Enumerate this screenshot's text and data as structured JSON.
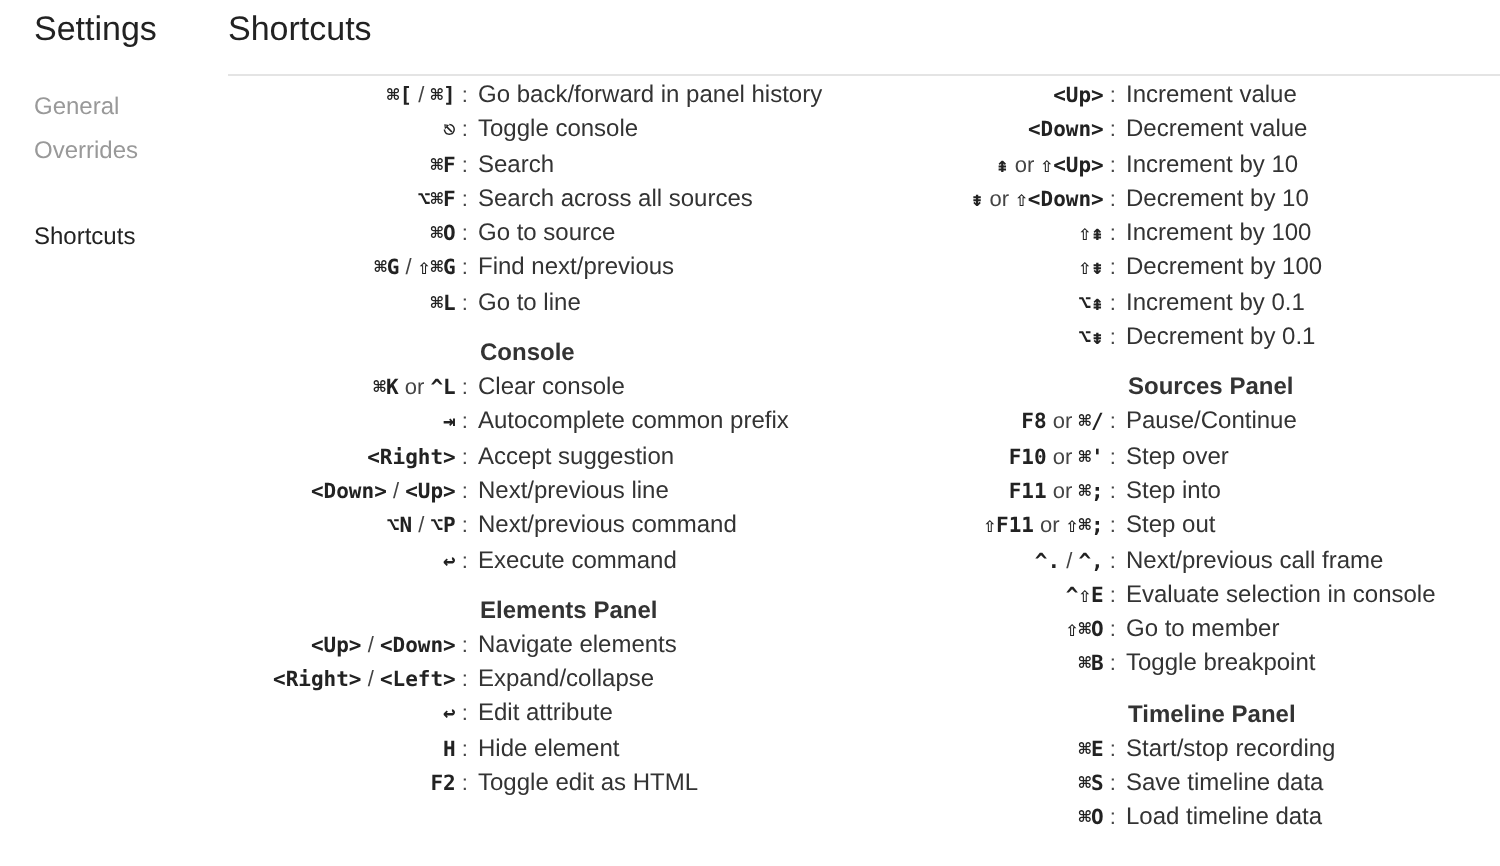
{
  "header": {
    "title": "Settings",
    "page_title": "Shortcuts"
  },
  "sidebar": {
    "items": [
      {
        "label": "General",
        "selected": false
      },
      {
        "label": "Overrides",
        "selected": false
      },
      {
        "label": "Shortcuts",
        "selected": true
      }
    ]
  },
  "columns": [
    {
      "sections": [
        {
          "rows": [
            {
              "keys": "**⌘[** / **⌘]** :",
              "action": "Go back/forward in panel history"
            },
            {
              "keys": "**⎋** :",
              "action": "Toggle console"
            },
            {
              "keys": "**⌘F** :",
              "action": "Search"
            },
            {
              "keys": "**⌥⌘F** :",
              "action": "Search across all sources"
            },
            {
              "keys": "**⌘O** :",
              "action": "Go to source"
            },
            {
              "keys": "**⌘G** / **⇧⌘G** :",
              "action": "Find next/previous"
            },
            {
              "keys": "**⌘L** :",
              "action": "Go to line"
            }
          ]
        },
        {
          "heading": "Console",
          "rows": [
            {
              "keys": "**⌘K** or **^L** :",
              "action": "Clear console"
            },
            {
              "keys": "**⇥** :",
              "action": "Autocomplete common prefix"
            },
            {
              "keys": "**<Right>** :",
              "action": "Accept suggestion"
            },
            {
              "keys": "**<Down>** / **<Up>** :",
              "action": "Next/previous line"
            },
            {
              "keys": "**⌥N** / **⌥P** :",
              "action": "Next/previous command"
            },
            {
              "keys": "**↩** :",
              "action": "Execute command"
            }
          ]
        },
        {
          "heading": "Elements Panel",
          "rows": [
            {
              "keys": "**<Up>** / **<Down>** :",
              "action": "Navigate elements"
            },
            {
              "keys": "**<Right>** / **<Left>** :",
              "action": "Expand/collapse"
            },
            {
              "keys": "**↩** :",
              "action": "Edit attribute"
            },
            {
              "keys": "**H** :",
              "action": "Hide element"
            },
            {
              "keys": "**F2** :",
              "action": "Toggle edit as HTML"
            }
          ]
        }
      ]
    },
    {
      "sections": [
        {
          "rows": [
            {
              "keys": "**<Up>** :",
              "action": "Increment value"
            },
            {
              "keys": "**<Down>** :",
              "action": "Decrement value"
            },
            {
              "keys": "**⇞** or **⇧<Up>** :",
              "action": "Increment by 10"
            },
            {
              "keys": "**⇟** or **⇧<Down>** :",
              "action": "Decrement by 10"
            },
            {
              "keys": "**⇧⇞** :",
              "action": "Increment by 100"
            },
            {
              "keys": "**⇧⇟** :",
              "action": "Decrement by 100"
            },
            {
              "keys": "**⌥⇞** :",
              "action": "Increment by 0.1"
            },
            {
              "keys": "**⌥⇟** :",
              "action": "Decrement by 0.1"
            }
          ]
        },
        {
          "heading": "Sources Panel",
          "rows": [
            {
              "keys": "**F8** or **⌘/** :",
              "action": "Pause/Continue"
            },
            {
              "keys": "**F10** or **⌘'** :",
              "action": "Step over"
            },
            {
              "keys": "**F11** or **⌘;** :",
              "action": "Step into"
            },
            {
              "keys": "**⇧F11** or **⇧⌘;** :",
              "action": "Step out"
            },
            {
              "keys": "**^.** / **^,** :",
              "action": "Next/previous call frame"
            },
            {
              "keys": "**^⇧E** :",
              "action": "Evaluate selection in console"
            },
            {
              "keys": "**⇧⌘O** :",
              "action": "Go to member"
            },
            {
              "keys": "**⌘B** :",
              "action": "Toggle breakpoint"
            }
          ]
        },
        {
          "heading": "Timeline Panel",
          "rows": [
            {
              "keys": "**⌘E** :",
              "action": "Start/stop recording"
            },
            {
              "keys": "**⌘S** :",
              "action": "Save timeline data"
            },
            {
              "keys": "**⌘O** :",
              "action": "Load timeline data"
            }
          ]
        }
      ]
    }
  ]
}
